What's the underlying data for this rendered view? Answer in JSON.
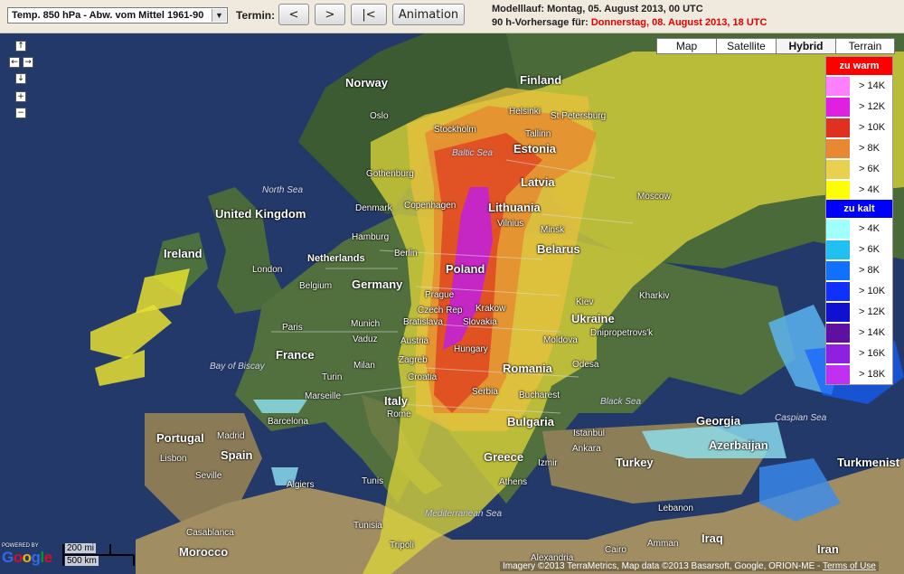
{
  "toolbar": {
    "field_select": "Temp. 850 hPa - Abw. vom Mittel 1961-90",
    "termin_label": "Termin:",
    "prev_label": "<",
    "next_label": ">",
    "first_label": "|<",
    "animation_label": "Animation",
    "modelllauf": "Modelllauf: Montag, 05. August 2013, 00 UTC",
    "forecast_prefix": "90 h-Vorhersage für:",
    "forecast_date": "Donnerstag, 08. August 2013, 18 UTC"
  },
  "map_types": [
    "Map",
    "Satellite",
    "Hybrid",
    "Terrain"
  ],
  "map_type_active": "Hybrid",
  "legend": {
    "warm_title": "zu warm",
    "warm_color": "#ff0000",
    "warm": [
      {
        "label": "> 14K",
        "color": "#ff80ff"
      },
      {
        "label": "> 12K",
        "color": "#e020e0"
      },
      {
        "label": "> 10K",
        "color": "#e03020"
      },
      {
        "label": "> 8K",
        "color": "#e88830"
      },
      {
        "label": "> 6K",
        "color": "#e8d050"
      },
      {
        "label": "> 4K",
        "color": "#ffff00"
      }
    ],
    "cold_title": "zu kalt",
    "cold_color": "#0000ff",
    "cold": [
      {
        "label": "> 4K",
        "color": "#a0ffff"
      },
      {
        "label": "> 6K",
        "color": "#20c0f0"
      },
      {
        "label": "> 8K",
        "color": "#1070ff"
      },
      {
        "label": "> 10K",
        "color": "#1030ff"
      },
      {
        "label": "> 12K",
        "color": "#1010d0"
      },
      {
        "label": "> 14K",
        "color": "#6010a0"
      },
      {
        "label": "> 16K",
        "color": "#9020e0"
      },
      {
        "label": "> 18K",
        "color": "#c030f0"
      }
    ]
  },
  "nav": {
    "up": "↑",
    "left": "←",
    "right": "→",
    "down": "↓",
    "zoom_in": "+",
    "zoom_out": "−"
  },
  "places": {
    "countries": [
      "Finland",
      "Norway",
      "Estonia",
      "Latvia",
      "Lithuania",
      "United Kingdom",
      "Ireland",
      "Netherlands",
      "Belgium",
      "Germany",
      "Poland",
      "Belarus",
      "Czech Rep",
      "Slovakia",
      "Ukraine",
      "France",
      "Austria",
      "Hungary",
      "Moldova",
      "Romania",
      "Croatia",
      "Serbia",
      "Italy",
      "Bulgaria",
      "Portugal",
      "Spain",
      "Greece",
      "Turkey",
      "Georgia",
      "Azerbaijan",
      "Turkmenist",
      "Morocco",
      "Tunisia",
      "Iraq",
      "Iran"
    ],
    "cities": [
      "Oslo",
      "Helsinki",
      "St Petersburg",
      "Tallinn",
      "Stockholm",
      "Gothenburg",
      "Denmark",
      "Copenhagen",
      "Moscow",
      "Vilnius",
      "Minsk",
      "Hamburg",
      "London",
      "Berlin",
      "Prague",
      "Krakow",
      "Kiev",
      "Kharkiv",
      "Paris",
      "Munich",
      "Vaduz",
      "Bratislava",
      "Dnipropetrovs'k",
      "Milan",
      "Turin",
      "Zagreb",
      "Odesa",
      "Marseille",
      "Bucharest",
      "Rome",
      "Barcelona",
      "Madrid",
      "Lisbon",
      "Seville",
      "Algiers",
      "Istanbul",
      "Ankara",
      "Izmir",
      "Athens",
      "Tunis",
      "Casablanca",
      "Tripoli",
      "Lebanon",
      "Amman",
      "Alexandria",
      "Cairo"
    ],
    "seas": [
      "North Sea",
      "Baltic Sea",
      "Bay of Biscay",
      "Black Sea",
      "Caspian Sea",
      "Mediterranean Sea"
    ]
  },
  "scale": {
    "miles": "200 mi",
    "km": "500 km"
  },
  "google": {
    "powered": "POWERED BY",
    "logo": "Google"
  },
  "credits": {
    "text": "Imagery ©2013 TerraMetrics, Map data ©2013 Basarsoft, Google, ORION-ME - ",
    "terms": "Terms of Use"
  }
}
